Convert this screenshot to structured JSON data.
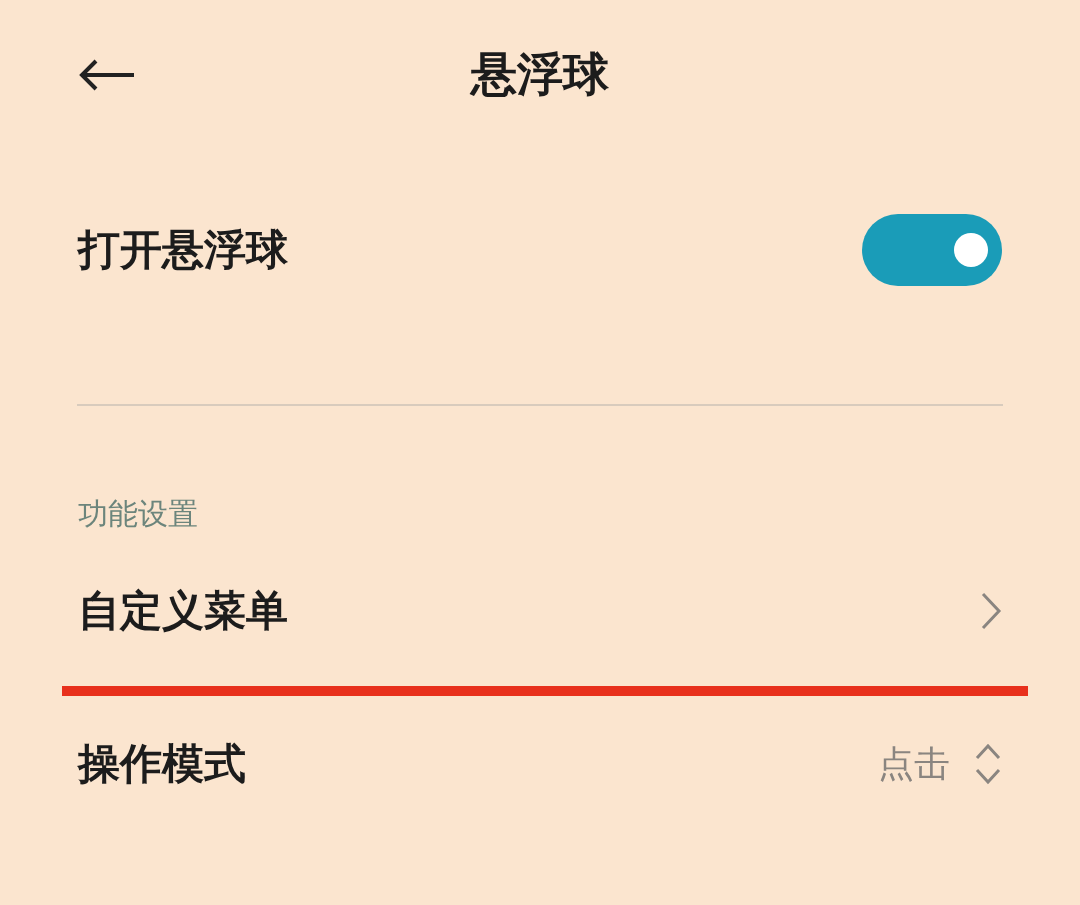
{
  "header": {
    "title": "悬浮球"
  },
  "toggle_row": {
    "label": "打开悬浮球",
    "on": true
  },
  "section": {
    "title": "功能设置"
  },
  "items": [
    {
      "kind": "link",
      "label": "自定义菜单",
      "highlighted": true
    },
    {
      "kind": "select",
      "label": "操作模式",
      "value": "点击",
      "highlighted": false
    }
  ]
}
